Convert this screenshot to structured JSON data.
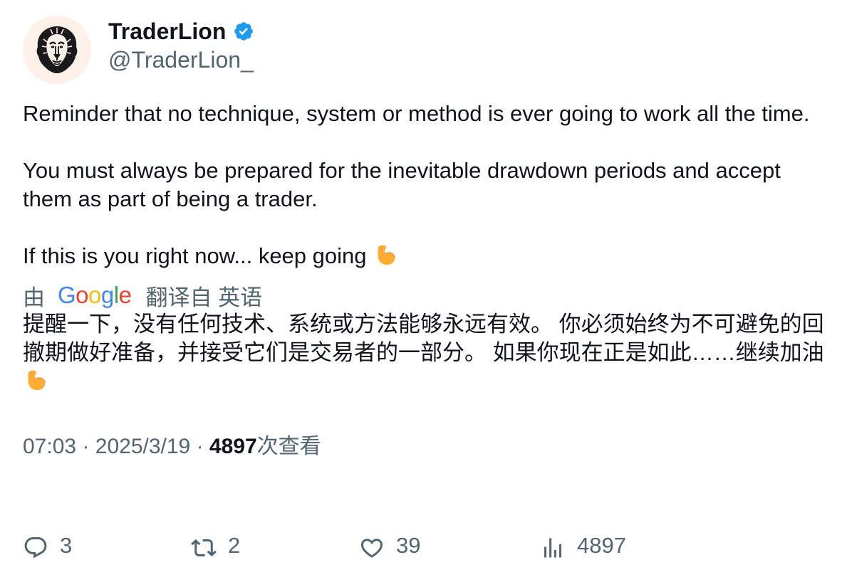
{
  "author": {
    "display_name": "TraderLion",
    "handle": "@TraderLion_",
    "avatar_icon": "lion-icon",
    "verified_icon": "verified-badge-icon",
    "verified_color": "#1d9bf0"
  },
  "tweet": {
    "paragraphs": [
      "Reminder that no technique, system or method is ever going to work all the time.",
      "You must always be prepared for the inevitable drawdown periods and accept them as part of being a trader.",
      "If this is you right now... keep going"
    ],
    "emoji_icon": "flexed-biceps-icon"
  },
  "translation": {
    "prefix": "由",
    "provider": "Google",
    "suffix": "翻译自 英语",
    "text": "提醒一下，没有任何技术、系统或方法能够永远有效。 你必须始终为不可避免的回撤期做好准备，并接受它们是交易者的一部分。 如果你现在正是如此……继续加油"
  },
  "meta": {
    "time": "07:03",
    "separator": "·",
    "date": "2025/3/19",
    "views_count": "4897",
    "views_label": "次查看"
  },
  "actions": {
    "replies": "3",
    "retweets": "2",
    "likes": "39",
    "views": "4897"
  },
  "colors": {
    "text_primary": "#0f1419",
    "text_secondary": "#536471",
    "google_blue": "#4285F4",
    "google_red": "#EA4335",
    "google_yellow": "#FBBC05",
    "google_green": "#34A853"
  }
}
